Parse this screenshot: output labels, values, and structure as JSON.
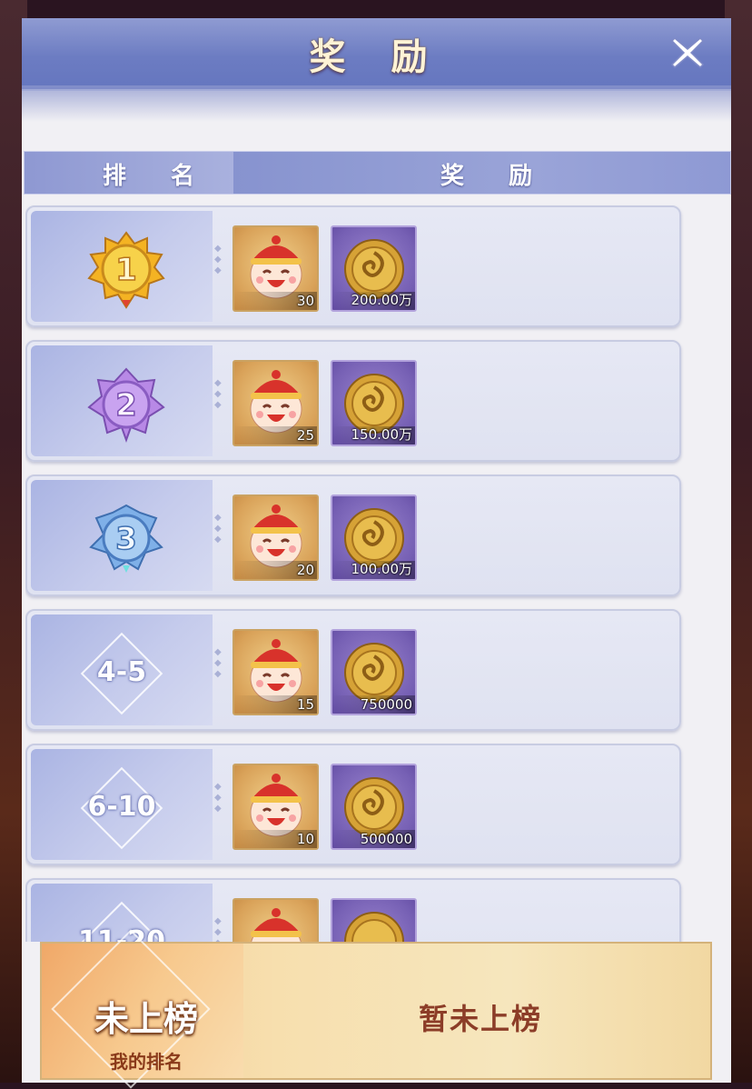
{
  "dialog": {
    "title": "奖 励"
  },
  "columns": {
    "rank": "排 名",
    "reward": "奖 励"
  },
  "rows": [
    {
      "rank": "1",
      "rank_style": "gold-medal",
      "rewards": [
        {
          "icon": "happy-face-icon",
          "qty": "30"
        },
        {
          "icon": "gold-coin-icon",
          "qty": "200.00万"
        }
      ]
    },
    {
      "rank": "2",
      "rank_style": "purple-medal",
      "rewards": [
        {
          "icon": "happy-face-icon",
          "qty": "25"
        },
        {
          "icon": "gold-coin-icon",
          "qty": "150.00万"
        }
      ]
    },
    {
      "rank": "3",
      "rank_style": "blue-medal",
      "rewards": [
        {
          "icon": "happy-face-icon",
          "qty": "20"
        },
        {
          "icon": "gold-coin-icon",
          "qty": "100.00万"
        }
      ]
    },
    {
      "rank": "4-5",
      "rank_style": "range",
      "rewards": [
        {
          "icon": "happy-face-icon",
          "qty": "15"
        },
        {
          "icon": "gold-coin-icon",
          "qty": "750000"
        }
      ]
    },
    {
      "rank": "6-10",
      "rank_style": "range",
      "rewards": [
        {
          "icon": "happy-face-icon",
          "qty": "10"
        },
        {
          "icon": "gold-coin-icon",
          "qty": "500000"
        }
      ]
    },
    {
      "rank": "11-20",
      "rank_style": "range",
      "rewards": [
        {
          "icon": "happy-face-icon",
          "qty": ""
        },
        {
          "icon": "gold-coin-icon",
          "qty": ""
        }
      ]
    }
  ],
  "footer": {
    "status": "未上榜",
    "label": "我的排名",
    "value": "暂未上榜"
  },
  "colors": {
    "header": "#6c7cc2",
    "medal_gold": "#f2c230",
    "medal_purple": "#b07ee0",
    "medal_blue": "#5e94d8",
    "footer": "#f6e0b0"
  }
}
